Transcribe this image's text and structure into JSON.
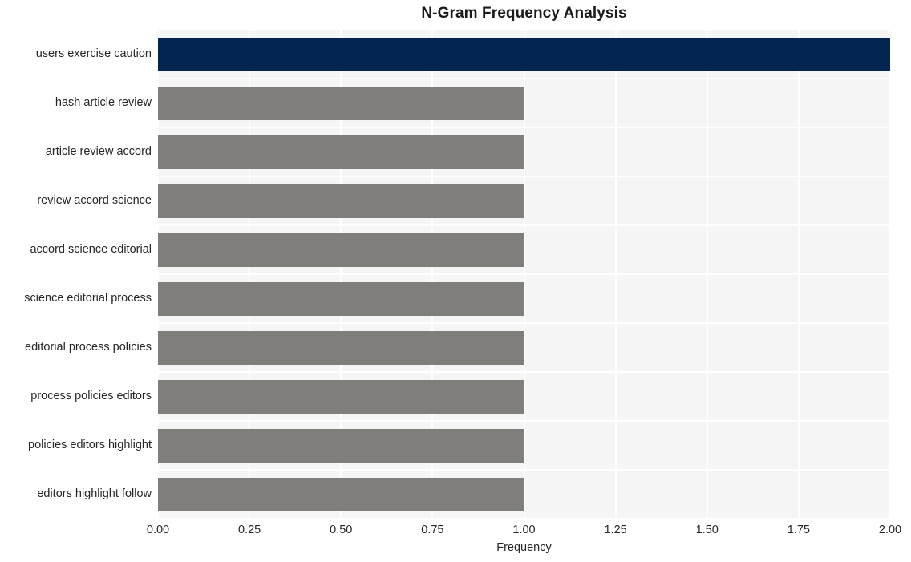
{
  "chart_data": {
    "type": "bar",
    "orientation": "horizontal",
    "title": "N-Gram Frequency Analysis",
    "xlabel": "Frequency",
    "ylabel": "",
    "categories": [
      "users exercise caution",
      "hash article review",
      "article review accord",
      "review accord science",
      "accord science editorial",
      "science editorial process",
      "editorial process policies",
      "process policies editors",
      "policies editors highlight",
      "editors highlight follow"
    ],
    "values": [
      2,
      1,
      1,
      1,
      1,
      1,
      1,
      1,
      1,
      1
    ],
    "xlim": [
      0.0,
      2.0
    ],
    "xticks": [
      0.0,
      0.25,
      0.5,
      0.75,
      1.0,
      1.25,
      1.5,
      1.75,
      2.0
    ],
    "xtick_labels": [
      "0.00",
      "0.25",
      "0.50",
      "0.75",
      "1.00",
      "1.25",
      "1.50",
      "1.75",
      "2.00"
    ],
    "bar_colors": [
      "#04254f",
      "#7f7e7b",
      "#7f7e7b",
      "#7f7e7b",
      "#7f7e7b",
      "#7f7e7b",
      "#7f7e7b",
      "#7f7e7b",
      "#7f7e7b",
      "#7f7e7b"
    ],
    "highlight_color": "#04254f",
    "default_color": "#7f7e7b",
    "plot_background": "#f5f5f5",
    "figure_background": "#ffffff",
    "grid_color": "#ffffff",
    "grid": {
      "vertical": true,
      "horizontal": true
    },
    "legend": null
  }
}
